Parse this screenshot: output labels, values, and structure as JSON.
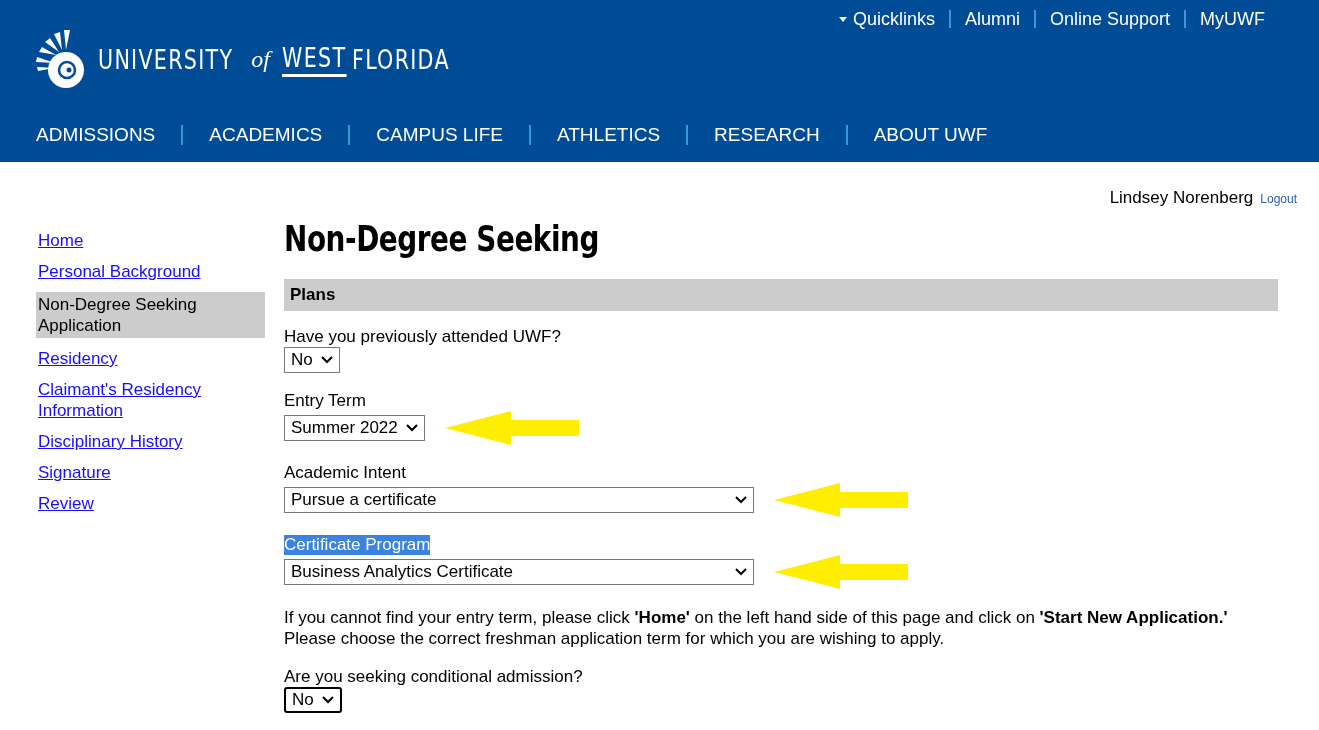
{
  "header": {
    "utility_links": [
      {
        "label": "Quicklinks",
        "dropdown": true
      },
      {
        "label": "Alumni",
        "dropdown": false
      },
      {
        "label": "Online Support",
        "dropdown": false
      },
      {
        "label": "MyUWF",
        "dropdown": false
      }
    ],
    "logo": {
      "word_1": "UNIVERSITY",
      "word_2": "of",
      "word_3": "WEST",
      "word_4": "FLORIDA"
    },
    "nav": [
      "ADMISSIONS",
      "ACADEMICS",
      "CAMPUS LIFE",
      "ATHLETICS",
      "RESEARCH",
      "ABOUT UWF"
    ]
  },
  "user": {
    "name": "Lindsey Norenberg",
    "logout": "Logout"
  },
  "sidebar": {
    "items": [
      {
        "label": "Home",
        "selected": false
      },
      {
        "label": "Personal Background",
        "selected": false
      },
      {
        "label": "Non-Degree Seeking Application",
        "selected": true
      },
      {
        "label": "Residency",
        "selected": false
      },
      {
        "label": "Claimant's Residency Information",
        "selected": false
      },
      {
        "label": "Disciplinary History",
        "selected": false
      },
      {
        "label": "Signature",
        "selected": false
      },
      {
        "label": "Review",
        "selected": false
      }
    ]
  },
  "page_title": "Non-Degree Seeking",
  "section": "Plans",
  "questions": [
    {
      "kind": "select",
      "label": "Have you previously attended UWF?",
      "value": "No",
      "long": false,
      "arrow": false,
      "highlighted": false,
      "focused": false
    },
    {
      "kind": "select",
      "label": "Entry Term",
      "value": "Summer 2022",
      "long": false,
      "arrow": true,
      "highlighted": false,
      "focused": false
    },
    {
      "kind": "select",
      "label": "Academic Intent",
      "value": "Pursue a certificate",
      "long": true,
      "arrow": true,
      "highlighted": false,
      "focused": false
    },
    {
      "kind": "select",
      "label": "Certificate Program",
      "value": "Business Analytics Certificate",
      "long": true,
      "arrow": true,
      "highlighted": true,
      "focused": false
    },
    {
      "kind": "note",
      "lines": [
        "If you cannot find your entry term, please click **'Home'** on the left hand side of this page and click on **'Start New Application.'**",
        "Please choose the correct freshman application term for which you are wishing to apply."
      ]
    },
    {
      "kind": "select",
      "label": "Are you seeking conditional admission?",
      "value": "No",
      "long": false,
      "arrow": false,
      "highlighted": false,
      "focused": true
    }
  ]
}
